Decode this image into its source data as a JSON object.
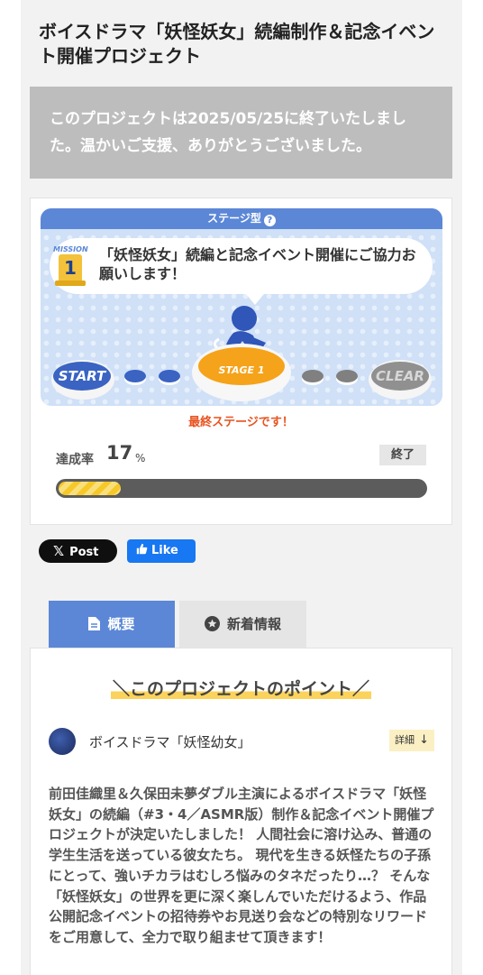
{
  "project": {
    "title": "ボイスドラマ「妖怪妖女」続編制作＆記念イベント開催プロジェクト",
    "ended_message": "このプロジェクトは2025/05/25に終了いたしました。温かいご支援、ありがとうございました。"
  },
  "stage": {
    "header_label": "ステージ型",
    "help_icon": "?",
    "mission_label": "MISSION",
    "mission_number": "1",
    "mission_text": "「妖怪妖女」続編と記念イベント開催にご協力お願いします！",
    "start_label": "START",
    "current_stage_label": "STAGE 1",
    "clear_label": "CLEAR",
    "final_stage_note": "最終ステージです！",
    "colors": {
      "primary": "#5b87d6",
      "accent": "#f5a31a",
      "note": "#e8531f"
    }
  },
  "achievement": {
    "label": "達成率",
    "value": "17",
    "unit": "%",
    "percent": 17,
    "status": "終了"
  },
  "social": {
    "x_post": "Post",
    "fb_like": "Like"
  },
  "tabs": [
    {
      "label": "概要",
      "icon": "document-icon",
      "active": true
    },
    {
      "label": "新着情報",
      "icon": "star-icon",
      "active": false
    }
  ],
  "overview": {
    "points_heading": "＼このプロジェクトのポイント／",
    "author_name": "ボイスドラマ「妖怪幼女」",
    "details_label": "詳細",
    "description": "前田佳織里＆久保田未夢ダブル主演によるボイスドラマ「妖怪妖女」の続編（#3・4／ASMR版）制作＆記念イベント開催プロジェクトが決定いたしました！ 人間社会に溶け込み、普通の学生生活を送っている彼女たち。 現代を生きる妖怪たちの子孫にとって、強いチカラはむしろ悩みのタネだったり…？ そんな「妖怪妖女」の世界を更に深く楽しんでいただけるよう、作品公開記念イベントの招待券やお見送り会などの特別なリワードをご用意して、全力で取り組ませて頂きます！"
  }
}
